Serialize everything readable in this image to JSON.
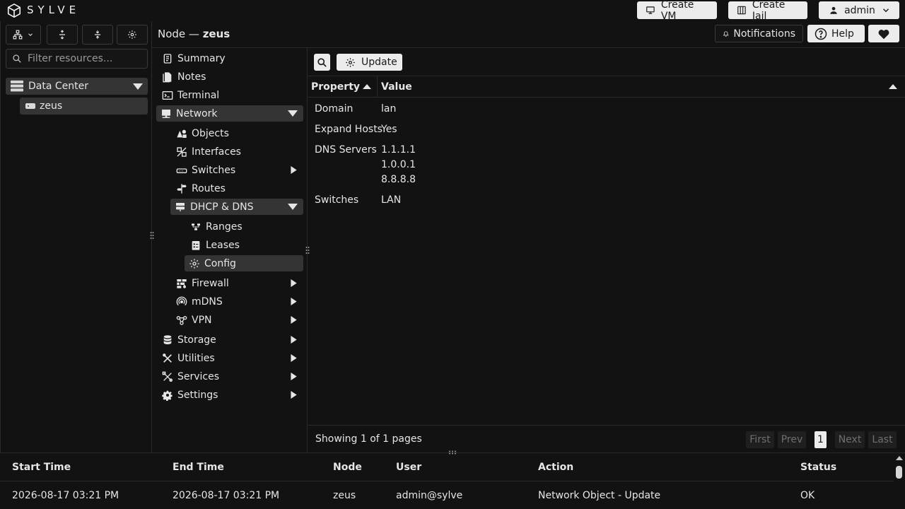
{
  "app": {
    "brand": "SYLVE"
  },
  "topbar": {
    "create_vm": "Create VM",
    "create_jail": "Create Jail",
    "user": "admin"
  },
  "sidebar": {
    "filter_placeholder": "Filter resources...",
    "tree": {
      "root_label": "Data Center",
      "node_label": "zeus"
    }
  },
  "header": {
    "breadcrumb_prefix": "Node —",
    "breadcrumb_node": "zeus",
    "notifications": "Notifications",
    "help": "Help"
  },
  "nav": {
    "summary": "Summary",
    "notes": "Notes",
    "terminal": "Terminal",
    "network": "Network",
    "objects": "Objects",
    "interfaces": "Interfaces",
    "switches": "Switches",
    "routes": "Routes",
    "dhcp_dns": "DHCP & DNS",
    "ranges": "Ranges",
    "leases": "Leases",
    "config": "Config",
    "firewall": "Firewall",
    "mdns": "mDNS",
    "vpn": "VPN",
    "storage": "Storage",
    "utilities": "Utilities",
    "services": "Services",
    "settings": "Settings"
  },
  "content": {
    "update_label": "Update",
    "columns": {
      "property": "Property",
      "value": "Value"
    },
    "rows": [
      {
        "property": "Domain",
        "value": "lan"
      },
      {
        "property": "Expand Hosts",
        "value": "Yes"
      },
      {
        "property": "DNS Servers",
        "values": [
          "1.1.1.1",
          "1.0.0.1",
          "8.8.8.8"
        ]
      },
      {
        "property": "Switches",
        "value": "LAN"
      }
    ],
    "pager": {
      "status": "Showing 1 of 1 pages",
      "first": "First",
      "prev": "Prev",
      "current": "1",
      "next": "Next",
      "last": "Last"
    }
  },
  "log": {
    "columns": {
      "start": "Start Time",
      "end": "End Time",
      "node": "Node",
      "user": "User",
      "action": "Action",
      "status": "Status"
    },
    "rows": [
      {
        "start": "2026-08-17 03:21 PM",
        "end": "2026-08-17 03:21 PM",
        "node": "zeus",
        "user": "admin@sylve",
        "action": "Network Object - Update",
        "status": "OK"
      }
    ]
  },
  "icons": {
    "logo": "cube-icon",
    "vm": "monitor-icon",
    "jail": "grid-icon",
    "user": "person-icon",
    "bell": "bell-icon",
    "help": "question-icon",
    "heart": "heart-icon"
  },
  "colors": {
    "background": "#121212",
    "active": "#343434",
    "light_button": "#ececec"
  }
}
